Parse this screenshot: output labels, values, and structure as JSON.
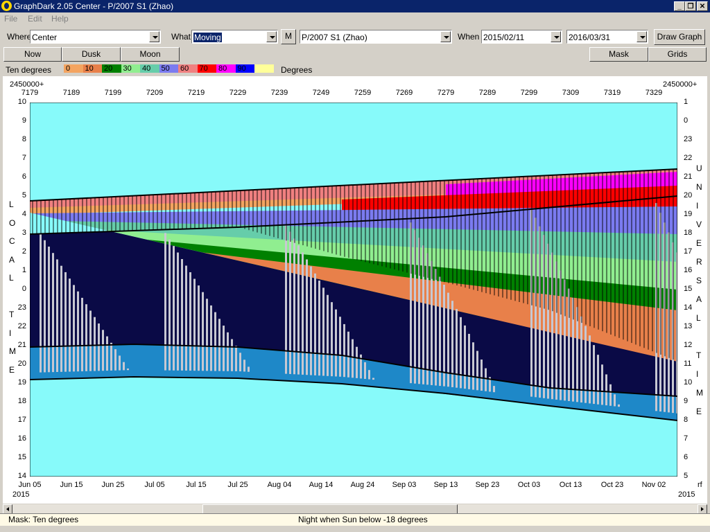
{
  "window": {
    "title": "GraphDark 2.05  Center  -  P/2007 S1 (Zhao)"
  },
  "menu": {
    "file": "File",
    "edit": "Edit",
    "help": "Help"
  },
  "toolbar": {
    "where_label": "Where",
    "where_value": "Center",
    "what_label": "What",
    "what_value": "Moving",
    "m_button": "M",
    "object_value": "P/2007 S1 (Zhao)",
    "when_label": "When",
    "start_date": "2015/02/11",
    "end_date": "2016/03/31",
    "draw_button": "Draw Graph"
  },
  "buttons": {
    "now": "Now",
    "dusk": "Dusk",
    "moon": "Moon",
    "mask": "Mask",
    "grids": "Grids"
  },
  "legend": {
    "label": "Ten degrees",
    "unit": "Degrees",
    "items": [
      {
        "label": "0",
        "color": "#f4a460"
      },
      {
        "label": "10",
        "color": "#e8804a"
      },
      {
        "label": "20",
        "color": "#008000"
      },
      {
        "label": "30",
        "color": "#90ee90"
      },
      {
        "label": "40",
        "color": "#66cdaa"
      },
      {
        "label": "50",
        "color": "#7b7bf0"
      },
      {
        "label": "60",
        "color": "#f08080"
      },
      {
        "label": "70",
        "color": "#ff0000"
      },
      {
        "label": "80",
        "color": "#ff00ff"
      },
      {
        "label": "90",
        "color": "#0000ff"
      },
      {
        "label": "",
        "color": "#ffff99"
      }
    ]
  },
  "graph": {
    "jd_prefix": "2450000+",
    "jd_ticks": [
      "7179",
      "7189",
      "7199",
      "7209",
      "7219",
      "7229",
      "7239",
      "7249",
      "7259",
      "7269",
      "7279",
      "7289",
      "7299",
      "7309",
      "7319",
      "7329"
    ],
    "local_label": "LOCAL TIME",
    "universal_label": "UNIVERSAL TIME",
    "local_ticks": [
      "10",
      "9",
      "8",
      "7",
      "6",
      "5",
      "4",
      "3",
      "2",
      "1",
      "0",
      "23",
      "22",
      "21",
      "20",
      "19",
      "18",
      "17",
      "16",
      "15",
      "14"
    ],
    "ut_ticks": [
      "1",
      "0",
      "23",
      "22",
      "21",
      "20",
      "19",
      "18",
      "17",
      "16",
      "15",
      "14",
      "13",
      "12",
      "11",
      "10",
      "9",
      "8",
      "7",
      "6",
      "5"
    ],
    "date_ticks": [
      "Jun 05",
      "Jun 15",
      "Jun 25",
      "Jul 05",
      "Jul 15",
      "Jul 25",
      "Aug 04",
      "Aug 14",
      "Aug 24",
      "Sep 03",
      "Sep 13",
      "Sep 23",
      "Oct 03",
      "Oct 13",
      "Oct 23",
      "Nov 02"
    ],
    "year_left": "2015",
    "year_right": "2015",
    "corner_label": "rf",
    "colors": {
      "day": "#87fafa",
      "twilight": "#1e88c8",
      "night": "#0a0a46",
      "moon": "#c8c8d2"
    }
  },
  "status": {
    "mask": "Mask:  Ten degrees",
    "night": "Night when Sun below -18 degrees"
  }
}
